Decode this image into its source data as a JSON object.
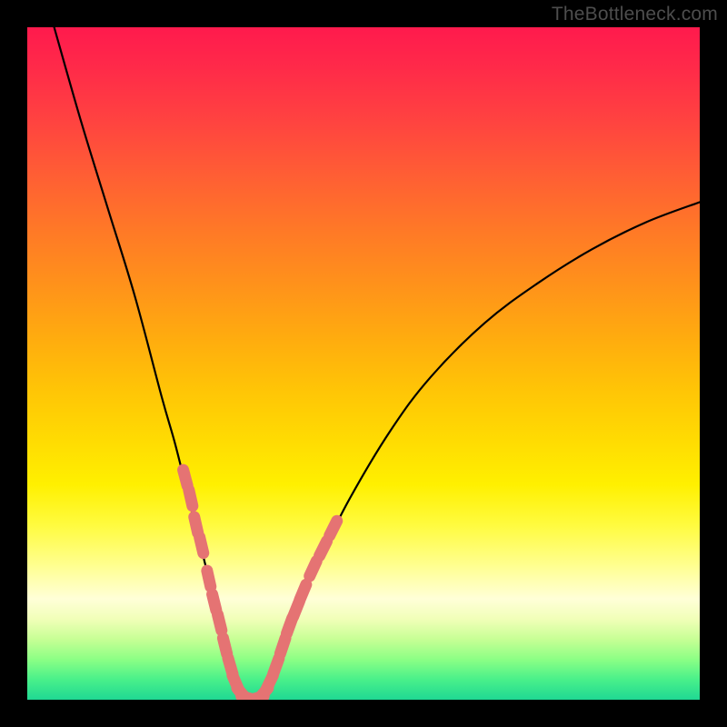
{
  "watermark": "TheBottleneck.com",
  "chart_data": {
    "type": "line",
    "title": "",
    "xlabel": "",
    "ylabel": "",
    "xlim": [
      0,
      100
    ],
    "ylim": [
      0,
      100
    ],
    "series": [
      {
        "name": "bottleneck-curve",
        "x": [
          4,
          8,
          12,
          16,
          20,
          22,
          24,
          26,
          27,
          28,
          29,
          30,
          31,
          32,
          33,
          34,
          35,
          36,
          38,
          40,
          44,
          48,
          54,
          60,
          68,
          76,
          84,
          92,
          100
        ],
        "y": [
          100,
          86,
          73,
          60,
          45,
          38,
          30,
          22,
          18,
          14,
          10,
          6,
          3,
          1,
          0,
          0,
          1,
          3,
          8,
          13,
          22,
          30,
          40,
          48,
          56,
          62,
          67,
          71,
          74
        ]
      }
    ],
    "markers": {
      "name": "highlighted-range",
      "color": "#e57373",
      "points": [
        {
          "x": 23.5,
          "y": 33
        },
        {
          "x": 24.3,
          "y": 30
        },
        {
          "x": 25.1,
          "y": 26
        },
        {
          "x": 25.9,
          "y": 23
        },
        {
          "x": 27.0,
          "y": 18
        },
        {
          "x": 27.8,
          "y": 14.5
        },
        {
          "x": 28.6,
          "y": 11.5
        },
        {
          "x": 29.4,
          "y": 8
        },
        {
          "x": 30.2,
          "y": 5
        },
        {
          "x": 31.0,
          "y": 2.5
        },
        {
          "x": 32.0,
          "y": 0.8
        },
        {
          "x": 33.0,
          "y": 0.2
        },
        {
          "x": 34.0,
          "y": 0.2
        },
        {
          "x": 35.0,
          "y": 0.8
        },
        {
          "x": 36.0,
          "y": 2.5
        },
        {
          "x": 37.0,
          "y": 5
        },
        {
          "x": 38.0,
          "y": 8
        },
        {
          "x": 39.0,
          "y": 11
        },
        {
          "x": 40.0,
          "y": 13.5
        },
        {
          "x": 41.0,
          "y": 16
        },
        {
          "x": 42.5,
          "y": 19.5
        },
        {
          "x": 44.0,
          "y": 22.5
        },
        {
          "x": 45.5,
          "y": 25.5
        }
      ]
    },
    "gradient_stops": [
      {
        "pos": 0,
        "color": "#ff1a4d"
      },
      {
        "pos": 50,
        "color": "#ffc506"
      },
      {
        "pos": 80,
        "color": "#ffff8f"
      },
      {
        "pos": 100,
        "color": "#1fd893"
      }
    ]
  }
}
